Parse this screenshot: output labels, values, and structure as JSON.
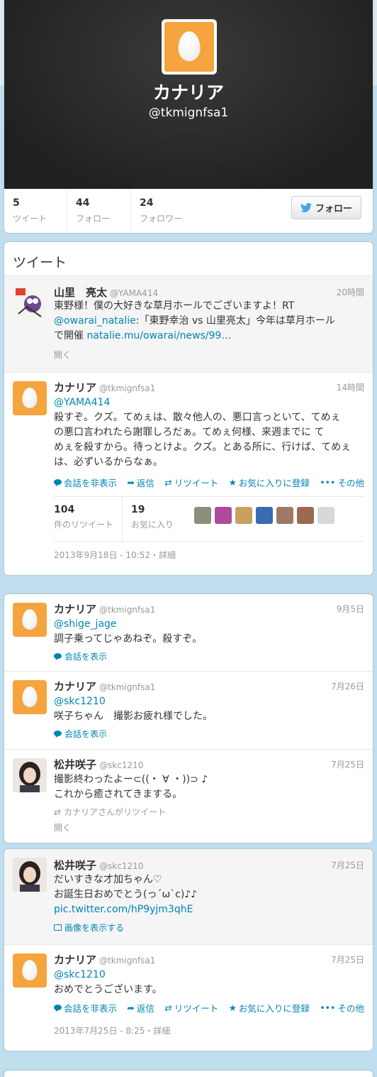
{
  "profile": {
    "name": "カナリア",
    "handle": "@tkmignfsa1",
    "stats": [
      {
        "value": "5",
        "label": "ツイート"
      },
      {
        "value": "44",
        "label": "フォロー"
      },
      {
        "value": "24",
        "label": "フォロワー"
      }
    ],
    "follow_label": "フォロー"
  },
  "stream": {
    "title": "ツイート",
    "t1": {
      "name": "山里　亮太",
      "handle": "@YAMA414",
      "time": "20時間",
      "text_a": "東野様！僕の大好きな草月ホールでございますよ！RT",
      "mention": "@owarai_natalie",
      "text_b": ":「東野幸治 vs 山里亮太」今年は草月ホール",
      "text_c": "で開催 ",
      "link": "natalie.mu/owarai/news/99…",
      "expand": "開く"
    },
    "t2": {
      "name": "カナリア",
      "handle": "@tkmignfsa1",
      "time": "14時間",
      "mention": "@YAMA414",
      "lines": [
        "殺すぞ。クズ。てめぇは、散々他人の、悪口言っといて、てめぇ",
        "の悪口言われたら謝罪しろだぁ。てめぇ何様、来週までに て",
        "めぇを殺すから。待っとけよ。クズ。とある所に、行けば、てめぇ",
        "は、必ずいるからなぁ。"
      ],
      "actions": [
        "会話を非表示",
        "返信",
        "リツイート",
        "お気に入りに登録",
        "その他"
      ],
      "retweets": "104",
      "retweets_label": "件のリツイート",
      "favorites": "19",
      "favorites_label": "お気に入り",
      "datetime": "2013年9月18日 - 10:52・詳細"
    }
  },
  "stream2": {
    "t3": {
      "name": "カナリア",
      "handle": "@tkmignfsa1",
      "time": "9月5日",
      "mention": "@shige_jage",
      "text": "調子乗ってじゃあねぞ。殺すぞ。",
      "convo": "会話を表示"
    },
    "t4": {
      "name": "カナリア",
      "handle": "@tkmignfsa1",
      "time": "7月26日",
      "mention": "@skc1210",
      "text": "咲子ちゃん　撮影お疲れ様でした。",
      "convo": "会話を表示"
    },
    "t5": {
      "name": "松井咲子",
      "handle": "@skc1210",
      "time": "7月25日",
      "line1": "撮影終わったよー⊂((・ ∀ ・))⊃ ♪",
      "line2": "これから癒されてきまする。",
      "retweeted_by": "カナリアさんがリツイート",
      "expand": "開く"
    }
  },
  "stream3": {
    "t6": {
      "name": "松井咲子",
      "handle": "@skc1210",
      "time": "7月25日",
      "line1": "だいすきな才加ちゃん♡",
      "line2": "お誕生日おめでとう(っ´ω`c)♪♪",
      "link": "pic.twitter.com/hP9yjm3qhE",
      "show_image": "画像を表示する"
    },
    "t7": {
      "name": "カナリア",
      "handle": "@tkmignfsa1",
      "time": "7月25日",
      "mention": "@skc1210",
      "text": "おめでとうございます。",
      "actions": [
        "会話を非表示",
        "返信",
        "リツイート",
        "お気に入りに登録",
        "その他"
      ],
      "datetime": "2013年7月25日 - 8:25・詳細"
    }
  },
  "colors": {
    "accent": "#0084b4",
    "egg_bg": "#f5a43e",
    "header_bg": "#262626",
    "page_bg": "#c0deed"
  }
}
